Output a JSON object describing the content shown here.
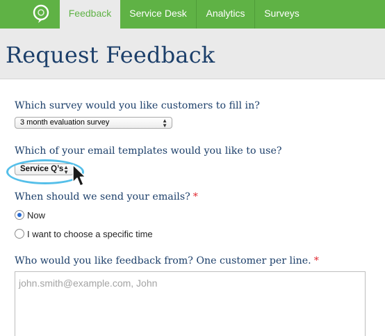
{
  "nav": {
    "logo_icon": "speech-bubble-logo-icon",
    "tabs": [
      {
        "label": "Feedback",
        "active": true
      },
      {
        "label": "Service Desk",
        "active": false
      },
      {
        "label": "Analytics",
        "active": false
      },
      {
        "label": "Surveys",
        "active": false
      }
    ]
  },
  "header": {
    "title": "Request Feedback"
  },
  "form": {
    "survey": {
      "question": "Which survey would you like customers to fill in?",
      "selected": "3 month evaluation survey"
    },
    "template": {
      "question": "Which of your email templates would you like to use?",
      "selected": "Service Q’s"
    },
    "schedule": {
      "question": "When should we send your emails?",
      "required_mark": "*",
      "options": [
        {
          "label": "Now",
          "checked": true
        },
        {
          "label": "I want to choose a specific time",
          "checked": false
        }
      ]
    },
    "recipients": {
      "question": "Who would you like feedback from? One customer per line.",
      "required_mark": "*",
      "placeholder": "john.smith@example.com, John"
    }
  },
  "colors": {
    "nav_green": "#5fb245",
    "title_navy": "#1c3f6a",
    "required_red": "#e0262e",
    "highlight_blue": "#55bfe9"
  }
}
